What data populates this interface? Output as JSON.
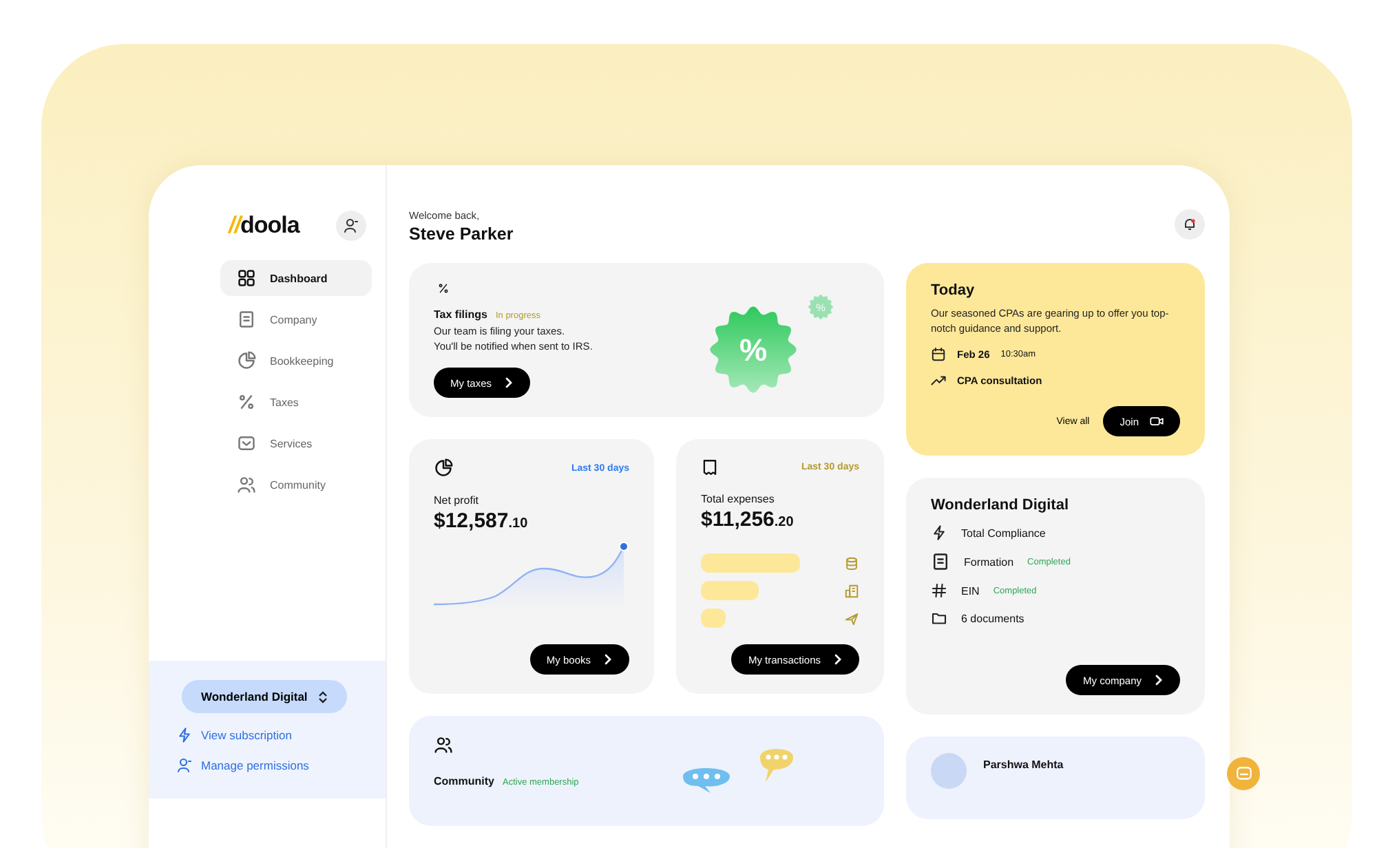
{
  "brand": {
    "logo_mark": "//",
    "logo_text": "doola"
  },
  "sidebar": {
    "items": [
      {
        "label": "Dashboard",
        "kind": "grid",
        "selected": true
      },
      {
        "label": "Company",
        "kind": "doc",
        "selected": false
      },
      {
        "label": "Bookkeeping",
        "kind": "pie",
        "selected": false
      },
      {
        "label": "Taxes",
        "kind": "percent",
        "selected": false
      },
      {
        "label": "Services",
        "kind": "inbox",
        "selected": false
      },
      {
        "label": "Community",
        "kind": "people",
        "selected": false
      }
    ],
    "workspace": "Wonderland Digital",
    "links": [
      {
        "label": "View subscription",
        "kind": "bolt"
      },
      {
        "label": "Manage permissions",
        "kind": "user"
      }
    ]
  },
  "header": {
    "greeting": "Welcome back,",
    "name": "Steve Parker"
  },
  "tax_card": {
    "title": "Tax filings",
    "status": "In progress",
    "text_lines": [
      "Our team is filing your taxes.",
      "You'll be notified when sent to IRS."
    ],
    "button": "My taxes",
    "badge": "%",
    "small_badge": "%"
  },
  "profit_card": {
    "period": "Last 30 days",
    "label": "Net profit",
    "amount": "$12,587",
    "cents": ".10",
    "button": "My books"
  },
  "expenses_card": {
    "period": "Last 30 days",
    "label": "Total expenses",
    "amount": "$11,256",
    "cents": ".20",
    "button": "My transactions"
  },
  "today_card": {
    "title": "Today",
    "text": "Our seasoned CPAs are gearing up to offer you top-notch guidance and support.",
    "date": "Feb 26",
    "time": "10:30am",
    "event": "CPA consultation",
    "view_all": "View all",
    "join": "Join"
  },
  "company_card": {
    "title": "Wonderland Digital",
    "items": [
      {
        "label": "Total Compliance",
        "kind": "bolt"
      },
      {
        "label": "Formation",
        "status": "Completed",
        "kind": "doc"
      },
      {
        "label": "EIN",
        "status": "Completed",
        "kind": "hash"
      },
      {
        "label": "6 documents",
        "kind": "folder"
      }
    ],
    "button": "My company"
  },
  "community_card": {
    "title": "Community",
    "status": "Active membership"
  },
  "person_card": {
    "name": "Parshwa Mehta"
  }
}
